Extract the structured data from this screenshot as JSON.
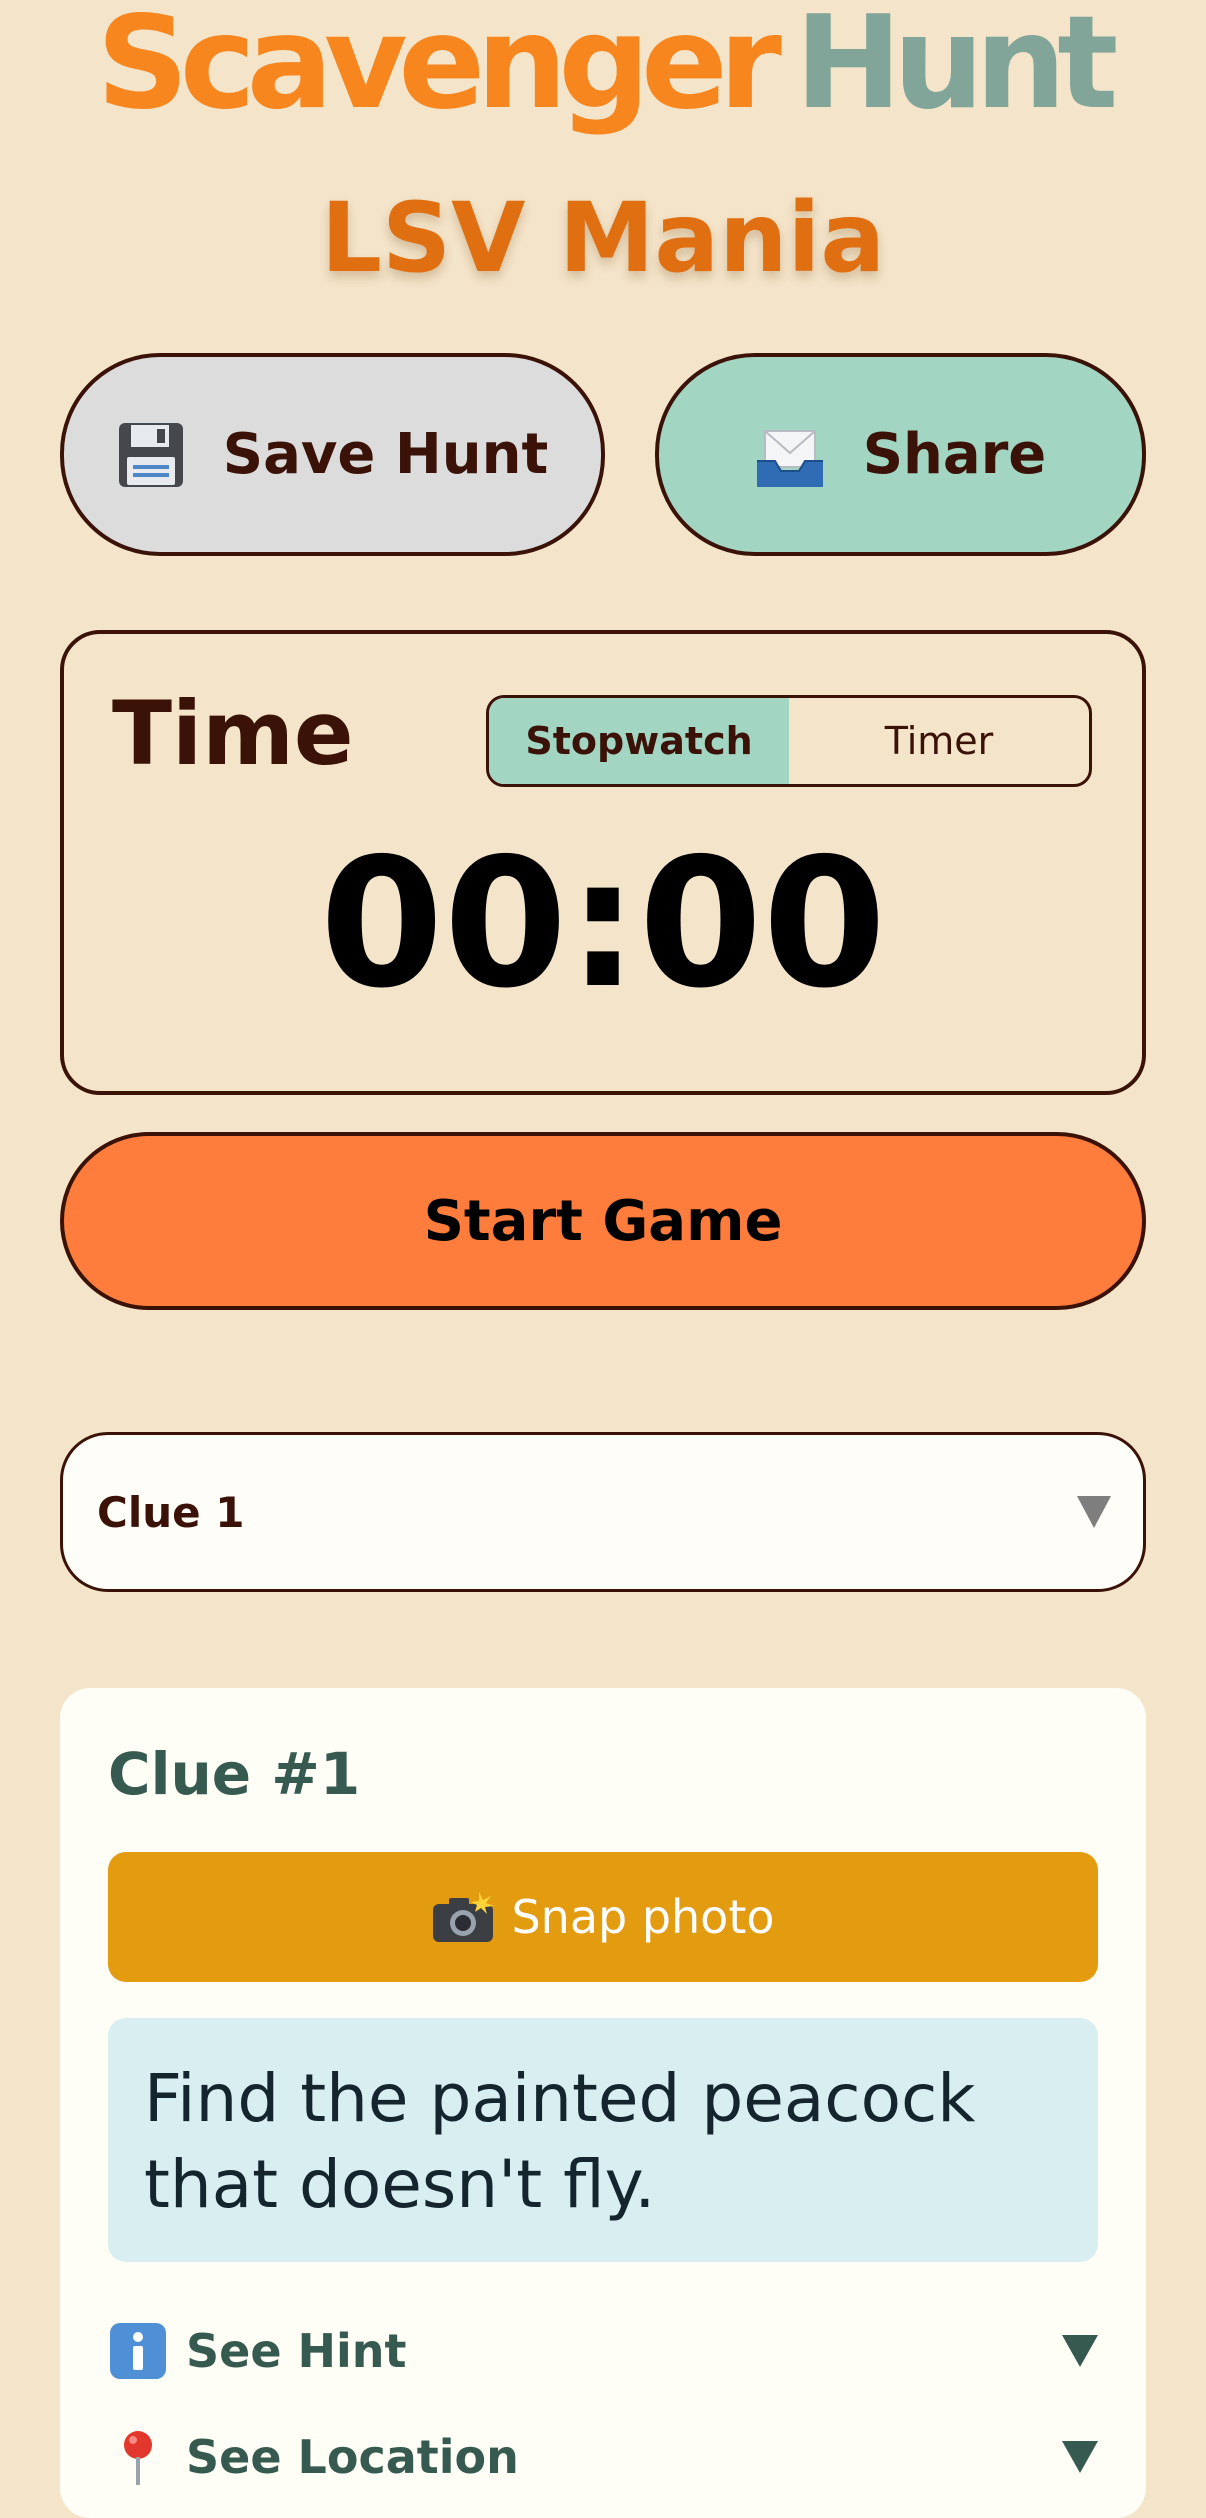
{
  "header": {
    "brand_word1": "Scavenger",
    "brand_word2": "Hunt",
    "title": "LSV Mania"
  },
  "actions": {
    "save_label": "Save Hunt",
    "save_icon": "floppy-disk-icon",
    "share_label": "Share",
    "share_icon": "envelope-tray-icon"
  },
  "time": {
    "label": "Time",
    "modes": [
      "Stopwatch",
      "Timer"
    ],
    "selected_mode": "Stopwatch",
    "display": "00:00"
  },
  "start_label": "Start Game",
  "clue_select": {
    "value": "Clue 1"
  },
  "clue_card": {
    "title": "Clue #1",
    "snap_label": "Snap photo",
    "text": "Find the painted peacock that doesn't fly.",
    "hint_label": "See Hint",
    "location_label": "See Location"
  },
  "colors": {
    "background": "#f4e4c9",
    "brand_orange": "#f7861f",
    "brand_sage": "#82a59a",
    "accent_mint": "#a3d5c3",
    "start_orange": "#ff7d3c",
    "snap_gold": "#e39b0f"
  }
}
